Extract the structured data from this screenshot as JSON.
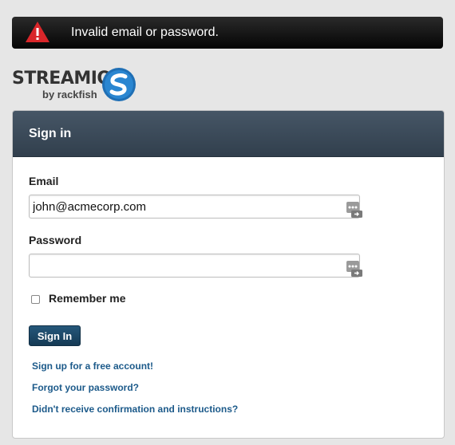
{
  "alert": {
    "message": "Invalid email or password.",
    "icon": "warning-icon",
    "icon_color": "#d9262a"
  },
  "logo": {
    "wordmark": "STREAMIO",
    "byline": "by rackfish",
    "mark_color": "#2a7fc6"
  },
  "panel": {
    "title": "Sign in"
  },
  "form": {
    "email_label": "Email",
    "email_value": "john@acmecorp.com",
    "password_label": "Password",
    "password_value": "",
    "remember_label": "Remember me",
    "remember_checked": false,
    "submit_label": "Sign In"
  },
  "links": {
    "signup": "Sign up for a free account!",
    "forgot": "Forgot your password?",
    "confirm": "Didn't receive confirmation and instructions?"
  },
  "colors": {
    "header": "#3a4a59",
    "button": "#1e4a6a",
    "link": "#1c5a8a"
  }
}
